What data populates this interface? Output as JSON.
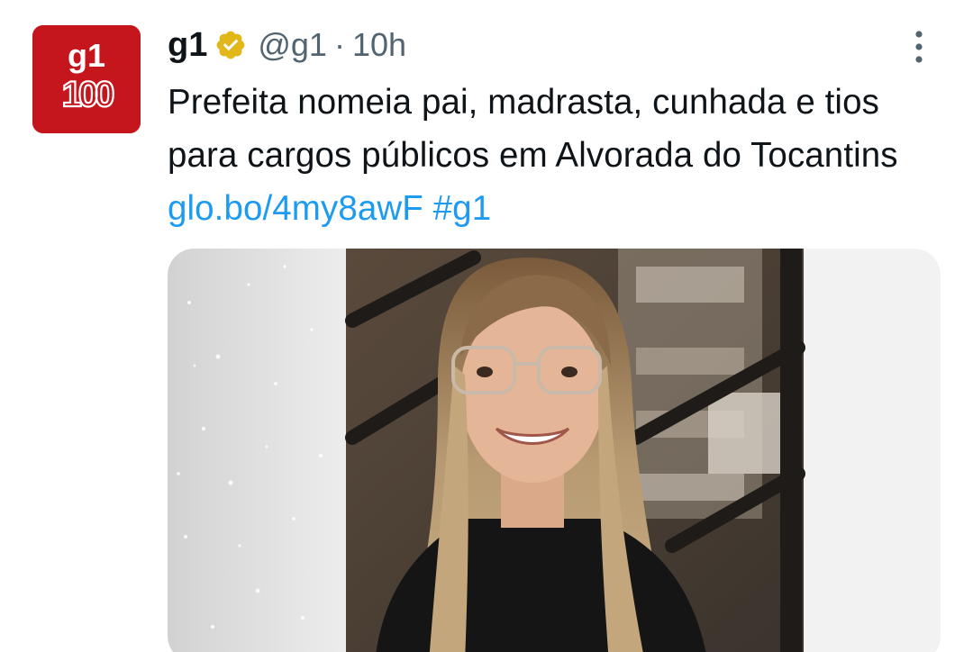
{
  "author": {
    "display_name": "g1",
    "handle": "@g1",
    "separator": "·",
    "time": "10h",
    "verified_badge_icon": "gold-verified-badge-icon",
    "avatar": {
      "logo_text_top": "g1",
      "logo_text_bottom": "100",
      "color": "#c4161c"
    }
  },
  "tweet": {
    "text": "Prefeita nomeia pai, madrasta, cunhada e tios para cargos públicos em Alvorada do Tocantins",
    "link": "glo.bo/4my8awF",
    "hashtag": "#g1"
  },
  "menu": {
    "icon": "more-options-icon"
  },
  "media": {
    "type": "photo"
  },
  "colors": {
    "link": "#1d9bf0",
    "secondary_text": "#536471",
    "brand_red": "#c4161c",
    "verified_gold": "#e2b719"
  }
}
